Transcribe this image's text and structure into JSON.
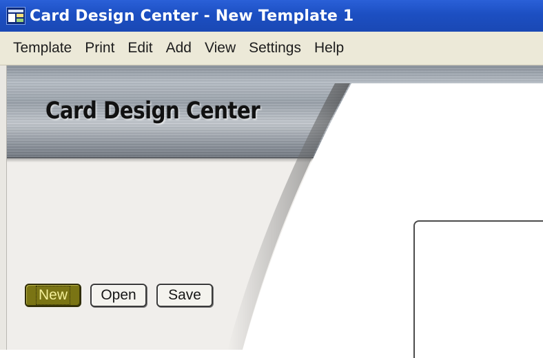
{
  "window": {
    "title": "Card Design Center - New Template 1",
    "title_bar_color": "#1c4fc2"
  },
  "menu": {
    "items": [
      "Template",
      "Print",
      "Edit",
      "Add",
      "View",
      "Settings",
      "Help"
    ]
  },
  "header": {
    "brand": "Card Design Center"
  },
  "toolbar": {
    "new_label": "New",
    "open_label": "Open",
    "save_label": "Save",
    "new_button_color": "#7a7414"
  }
}
